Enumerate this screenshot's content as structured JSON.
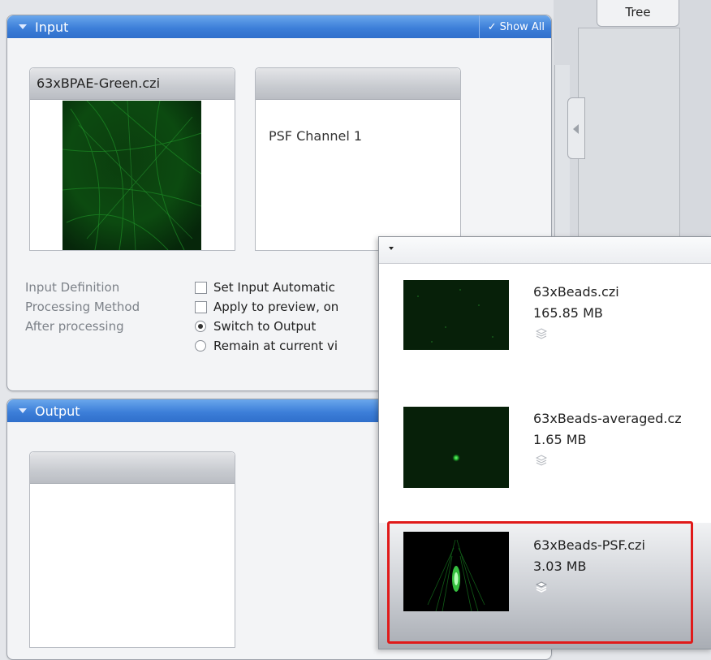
{
  "input_panel": {
    "title": "Input",
    "show_all_label": "Show All",
    "source_card": {
      "title": "63xBPAE-Green.czi"
    },
    "psf_card": {
      "title": "",
      "channel_label": "PSF Channel 1"
    },
    "rows": [
      {
        "label": "Input Definition",
        "option": "Set Input Automatic"
      },
      {
        "label": "Processing Method",
        "option": "Apply to preview, on"
      },
      {
        "label": "After processing",
        "option": "Switch to Output"
      }
    ],
    "radio_second_option": "Remain at current vi",
    "after_processing_selected": "Switch to Output"
  },
  "output_panel": {
    "title": "Output",
    "card": {
      "title": ""
    }
  },
  "right_rail": {
    "tree_tab_label": "Tree"
  },
  "dropdown": {
    "items": [
      {
        "name": "63xBeads.czi",
        "size": "165.85 MB",
        "selected": false
      },
      {
        "name": "63xBeads-averaged.cz",
        "size": "1.65 MB",
        "selected": false
      },
      {
        "name": "63xBeads-PSF.czi",
        "size": "3.03 MB",
        "selected": true
      }
    ]
  },
  "icons": {
    "panel_caret": "chevron-down-icon",
    "show_all_check": "check-icon",
    "play": "play-icon",
    "stack": "layers-icon",
    "splitter": "chevron-left-icon"
  },
  "colors": {
    "header_blue": "#3d7fd9",
    "selection_outline": "#e01a1a",
    "image_green": "#1fa82a"
  }
}
